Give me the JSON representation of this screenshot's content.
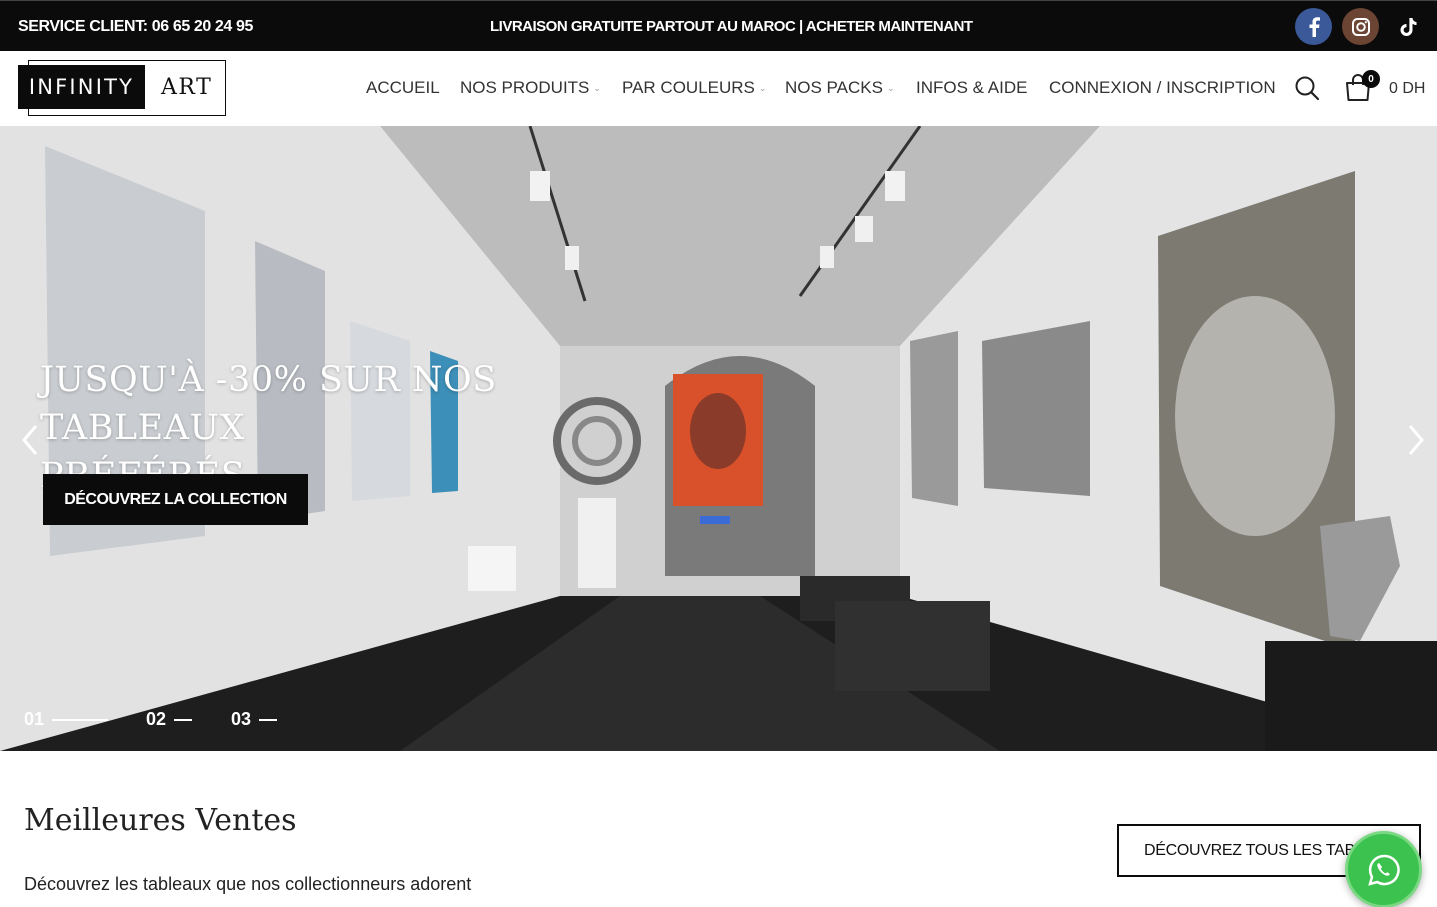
{
  "topbar": {
    "service": "SERVICE CLIENT: 06 65 20 24 95",
    "promo": "LIVRAISON GRATUITE PARTOUT AU MAROC | ACHETER MAINTENANT",
    "social": [
      "facebook-icon",
      "instagram-icon",
      "tiktok-icon"
    ],
    "colors": {
      "facebook": "#3b5998",
      "instagram": "#6b4434"
    }
  },
  "header": {
    "logo_left": "INFINITY",
    "logo_right": "ART",
    "nav": {
      "accueil": "ACCUEIL",
      "produits": "NOS PRODUITS",
      "couleurs": "PAR COULEURS",
      "packs": "NOS PACKS",
      "infos": "INFOS & AIDE",
      "connexion": "CONNEXION / INSCRIPTION"
    },
    "cart_count": "0",
    "cart_total": "0 DH"
  },
  "hero": {
    "title_line1": "JUSQU'À -30% SUR NOS TABLEAUX",
    "title_line2": "PRÉFÉRÉS",
    "button": "DÉCOUVREZ LA COLLECTION",
    "slides": [
      "01",
      "02",
      "03"
    ]
  },
  "bestsellers": {
    "title": "Meilleures Ventes",
    "subtitle": "Découvrez les tableaux que nos collectionneurs adorent",
    "button": "DÉCOUVREZ TOUS LES TABL"
  },
  "whatsapp_color": "#3cc24f"
}
